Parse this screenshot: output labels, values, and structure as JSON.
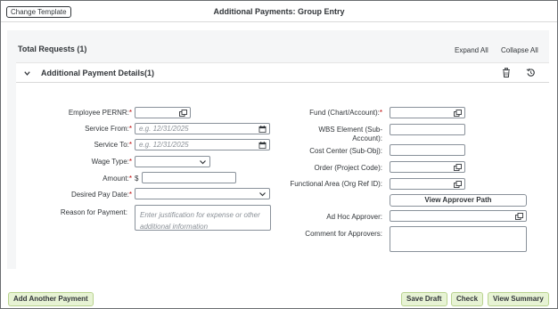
{
  "header": {
    "change_template": "Change Template",
    "title": "Additional Payments: Group Entry"
  },
  "summary": {
    "total_requests": "Total Requests (1)",
    "expand_all": "Expand All",
    "collapse_all": "Collapse All"
  },
  "panel": {
    "title": "Additional Payment Details(1)"
  },
  "left_fields": {
    "employee_pernr": "Employee PERNR:",
    "service_from": "Service From:",
    "service_from_ph": "e.g. 12/31/2025",
    "service_to": "Service To:",
    "service_to_ph": "e.g. 12/31/2025",
    "wage_type": "Wage Type:",
    "amount": "Amount:",
    "currency": "$",
    "desired_pay_date": "Desired Pay Date:",
    "reason": "Reason for Payment:",
    "reason_ph": "Enter justification for expense or other additional information"
  },
  "right_fields": {
    "fund": "Fund (Chart/Account):",
    "wbs_line1": "WBS Element (Sub-",
    "wbs_line2": "Account):",
    "cost_center": "Cost Center (Sub-Obj):",
    "order": "Order (Project Code):",
    "functional_area": "Functional Area (Org Ref ID):",
    "view_approver_path": "View Approver Path",
    "ad_hoc_approver": "Ad Hoc Approver:",
    "comment": "Comment for Approvers:"
  },
  "required_marker": "*",
  "footer": {
    "add_another": "Add Another Payment",
    "save_draft": "Save Draft",
    "check": "Check",
    "view_summary": "View Summary"
  },
  "colors": {
    "required": "#bb0000",
    "footer_button_bg": "#e7f3d4"
  }
}
